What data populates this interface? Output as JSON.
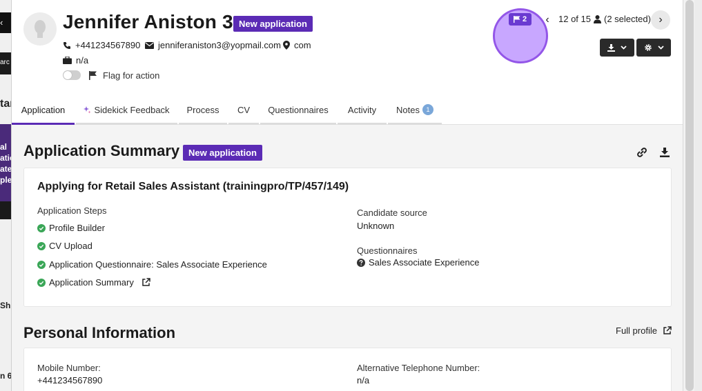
{
  "background": {
    "fragments": [
      "arc",
      "al",
      "atic",
      "ate",
      "ple",
      "Sh",
      "n 6",
      "tar"
    ]
  },
  "candidate": {
    "name": "Jennifer Aniston 3",
    "status_badge": "New application",
    "phone": "+441234567890",
    "email": "jenniferaniston3@yopmail.com",
    "location": "com",
    "company": "n/a",
    "flag_label": "Flag for action",
    "flag_enabled": false
  },
  "navigation": {
    "flag_count": "2",
    "position": "12 of 15",
    "selected": "(2 selected)"
  },
  "tabs": [
    {
      "label": "Application",
      "active": true
    },
    {
      "label": "Sidekick Feedback",
      "active": false
    },
    {
      "label": "Process",
      "active": false
    },
    {
      "label": "CV",
      "active": false
    },
    {
      "label": "Questionnaires",
      "active": false
    },
    {
      "label": "Activity",
      "active": false
    },
    {
      "label": "Notes",
      "active": false,
      "count": "1"
    }
  ],
  "summary": {
    "title": "Application Summary",
    "badge": "New application",
    "applying_for": "Applying for Retail Sales Assistant (trainingpro/TP/457/149)",
    "steps_label": "Application Steps",
    "steps": [
      "Profile Builder",
      "CV Upload",
      "Application Questionnaire: Sales Associate Experience",
      "Application Summary"
    ],
    "source_label": "Candidate source",
    "source_value": "Unknown",
    "questionnaires_label": "Questionnaires",
    "questionnaire": "Sales Associate Experience"
  },
  "personal": {
    "title": "Personal Information",
    "full_profile": "Full profile",
    "mobile_label": "Mobile Number:",
    "mobile_value": "+441234567890",
    "alt_phone_label": "Alternative Telephone Number:",
    "alt_phone_value": "n/a"
  },
  "colors": {
    "accent": "#5b2bb5",
    "success": "#3aa657",
    "highlight": "#9356e8"
  }
}
